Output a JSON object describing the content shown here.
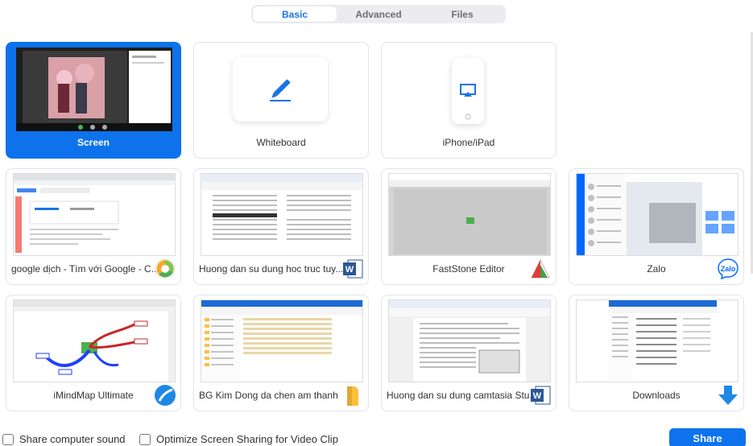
{
  "tabs": [
    {
      "label": "Basic",
      "active": true
    },
    {
      "label": "Advanced",
      "active": false
    },
    {
      "label": "Files",
      "active": false
    }
  ],
  "sources": [
    {
      "label": "Screen",
      "selected": true,
      "icon": "screen-preview"
    },
    {
      "label": "Whiteboard",
      "selected": false,
      "icon": "pen-icon"
    },
    {
      "label": "iPhone/iPad",
      "selected": false,
      "icon": "airplay-icon"
    },
    {
      "label": "google dịch - Tìm với Google - C...",
      "selected": false,
      "icon": "chrome-icon"
    },
    {
      "label": "Huong dan su dung hoc truc tuy...",
      "selected": false,
      "icon": "word-icon"
    },
    {
      "label": "FastStone Editor",
      "selected": false,
      "icon": "faststone-icon"
    },
    {
      "label": "Zalo",
      "selected": false,
      "icon": "zalo-icon"
    },
    {
      "label": "iMindMap Ultimate",
      "selected": false,
      "icon": "imindmap-icon"
    },
    {
      "label": "BG Kim Dong da chen am thanh",
      "selected": false,
      "icon": "folder-icon"
    },
    {
      "label": "Huong dan su dung camtasia Stu...",
      "selected": false,
      "icon": "word-icon"
    },
    {
      "label": "Downloads",
      "selected": false,
      "icon": "download-arrow-icon"
    }
  ],
  "options": {
    "share_sound": "Share computer sound",
    "optimize_video": "Optimize Screen Sharing for Video Clip"
  },
  "share_button": "Share",
  "colors": {
    "accent": "#0e72ed",
    "tab_active_text": "#1a73e8",
    "word_blue": "#2b5797",
    "zalo_blue": "#0068ff"
  }
}
